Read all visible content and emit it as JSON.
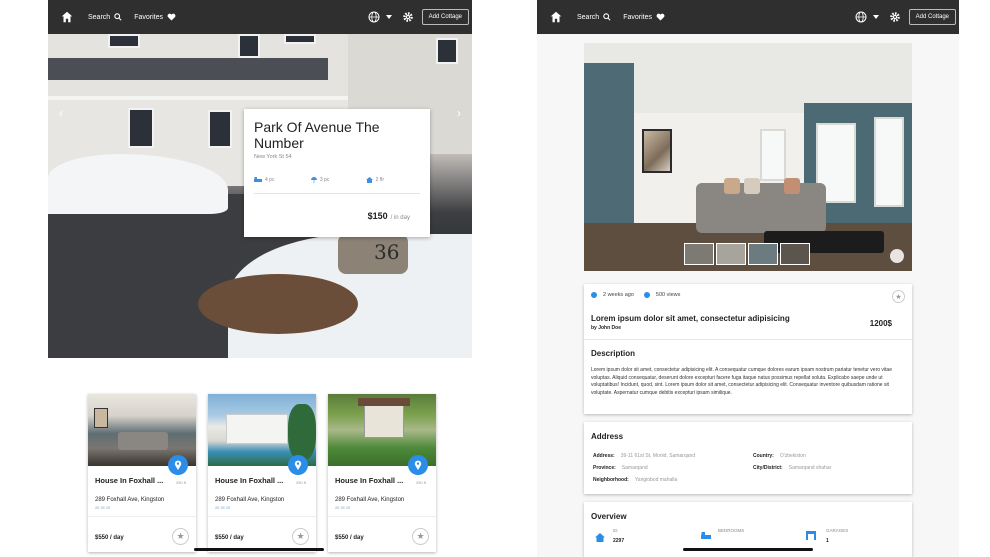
{
  "nav": {
    "search_label": "Search",
    "favorites_label": "Favorites",
    "add_cottage_label": "Add Cottage"
  },
  "left": {
    "hero": {
      "house_number": "36",
      "prev_arrow": "‹",
      "next_arrow": "›"
    },
    "feature": {
      "title": "Park Of Avenue The Number",
      "address": "New York St 54",
      "amenities": [
        {
          "icon": "bed-icon",
          "label": "4 pc"
        },
        {
          "icon": "shower-icon",
          "label": "3 pc"
        },
        {
          "icon": "home-icon",
          "label": "2 flr"
        }
      ],
      "price": "$150",
      "price_unit": "/ in day"
    },
    "listings": [
      {
        "title": "House In Foxhall ...",
        "area": "250 ft",
        "address": "289 Foxhall Ave, Kingston",
        "icons": "2fl  2fl  2fl",
        "price": "$550 / day"
      },
      {
        "title": "House In Foxhall ...",
        "area": "250 ft",
        "address": "289 Foxhall Ave, Kingston",
        "icons": "2fl  2fl  2fl",
        "price": "$550 / day"
      },
      {
        "title": "House In Foxhall ...",
        "area": "250 ft",
        "address": "289 Foxhall Ave, Kingston",
        "icons": "2fl  2fl  2fl",
        "price": "$550 / day"
      }
    ]
  },
  "right": {
    "meta": {
      "time_ago": "2 weeks ago",
      "views": "500 views"
    },
    "post": {
      "title": "Lorem ipsum dolor sit amet, consectetur adipisicing",
      "price": "1200$",
      "author": "by John Doe"
    },
    "description": {
      "heading": "Description",
      "text": "Lorem ipsum dolor sit amet, consectetur adipisicing elit. A consequatur cumque dolores earum ipsam nostrum pariatur tenetur vero vitae voluptas. Aliquid consequatur, deserunt dolore excepturi facere fuga itaque natus possimus repellat soluta. Explicabo saepe unde ut voluptatibus! Incidunt, quod, sint. Lorem ipsum dolor sit amet, consectetur adipisicing elit. Consequatur inventore quibusdam ratione sit voluptate. Aspernatur cumque debitis excepturi ipsam similique."
    },
    "address": {
      "heading": "Address",
      "address_label": "Address:",
      "address_value": "39-11 61st St, Moriid, Samarqand",
      "country_label": "Country:",
      "country_value": "O'zbekiston",
      "province_label": "Province:",
      "province_value": "Samarqand",
      "city_label": "City/District:",
      "city_value": "Samarqand shahar",
      "neighborhood_label": "Neighborhood:",
      "neighborhood_value": "Yangiobod mahalla"
    },
    "overview": {
      "heading": "Overview",
      "id_label": "ID",
      "id_value": "2297",
      "bedrooms_label": "BEDROOMS",
      "garages_label": "GARAGES",
      "garages_value": "1"
    }
  }
}
